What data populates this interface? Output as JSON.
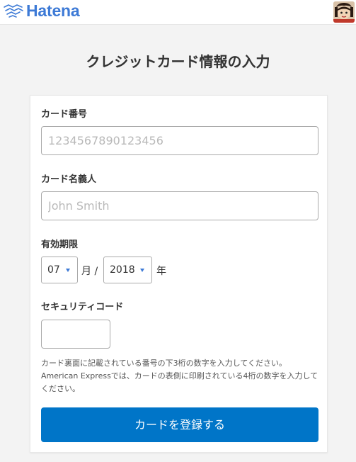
{
  "header": {
    "brand": "Hatena",
    "brand_color": "#3d7ad6"
  },
  "page": {
    "title": "クレジットカード情報の入力"
  },
  "form": {
    "card_number": {
      "label": "カード番号",
      "placeholder": "1234567890123456",
      "value": ""
    },
    "card_holder": {
      "label": "カード名義人",
      "placeholder": "John Smith",
      "value": ""
    },
    "expiry": {
      "label": "有効期限",
      "month_value": "07",
      "month_unit": "月 /",
      "year_value": "2018",
      "year_unit": "年"
    },
    "security_code": {
      "label": "セキュリティコード",
      "value": ""
    },
    "help_text": "カード裏面に記載されている番号の下3桁の数字を入力してください。American Expressでは、カードの表側に印刷されている4桁の数字を入力してください。",
    "submit_label": "カードを登録する",
    "submit_color": "#0075c8"
  }
}
